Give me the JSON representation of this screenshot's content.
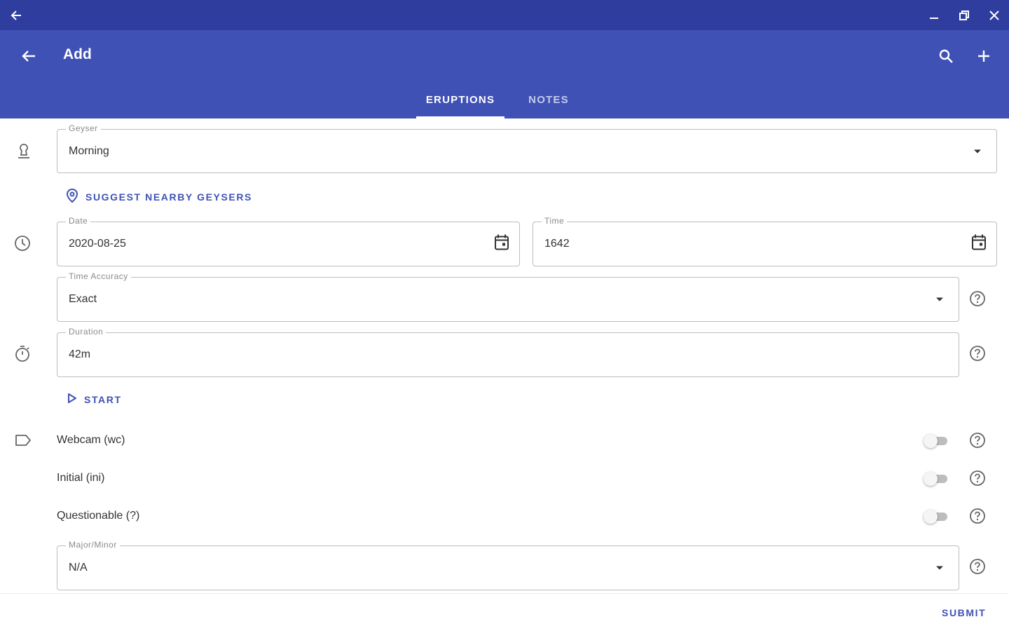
{
  "window": {
    "back_icon": "arrow-left-icon",
    "controls": [
      "minimize-icon",
      "restore-icon",
      "close-icon"
    ]
  },
  "appbar": {
    "title": "Add",
    "actions": [
      "search-icon",
      "add-icon"
    ]
  },
  "tabs": [
    {
      "label": "ERUPTIONS",
      "active": true
    },
    {
      "label": "NOTES",
      "active": false
    }
  ],
  "form": {
    "geyser": {
      "label": "Geyser",
      "value": "Morning",
      "icon": "geyser-icon"
    },
    "suggest_button": {
      "label": "SUGGEST NEARBY GEYSERS",
      "icon": "location-pin-icon"
    },
    "date": {
      "label": "Date",
      "value": "2020-08-25",
      "icon": "calendar-icon"
    },
    "time": {
      "label": "Time",
      "value": "1642",
      "icon": "calendar-icon"
    },
    "time_accuracy": {
      "label": "Time Accuracy",
      "value": "Exact"
    },
    "duration": {
      "label": "Duration",
      "value": "42m"
    },
    "start_button": {
      "label": "START",
      "icon": "play-outline-icon"
    },
    "switches": [
      {
        "label": "Webcam (wc)",
        "on": false
      },
      {
        "label": "Initial (ini)",
        "on": false
      },
      {
        "label": "Questionable (?)",
        "on": false
      }
    ],
    "major_minor": {
      "label": "Major/Minor",
      "value": "N/A"
    }
  },
  "submit_label": "SUBMIT",
  "colors": {
    "titlebar": "#2f3e9e",
    "appbar": "#3f51b5",
    "accent": "#3f51b5"
  }
}
